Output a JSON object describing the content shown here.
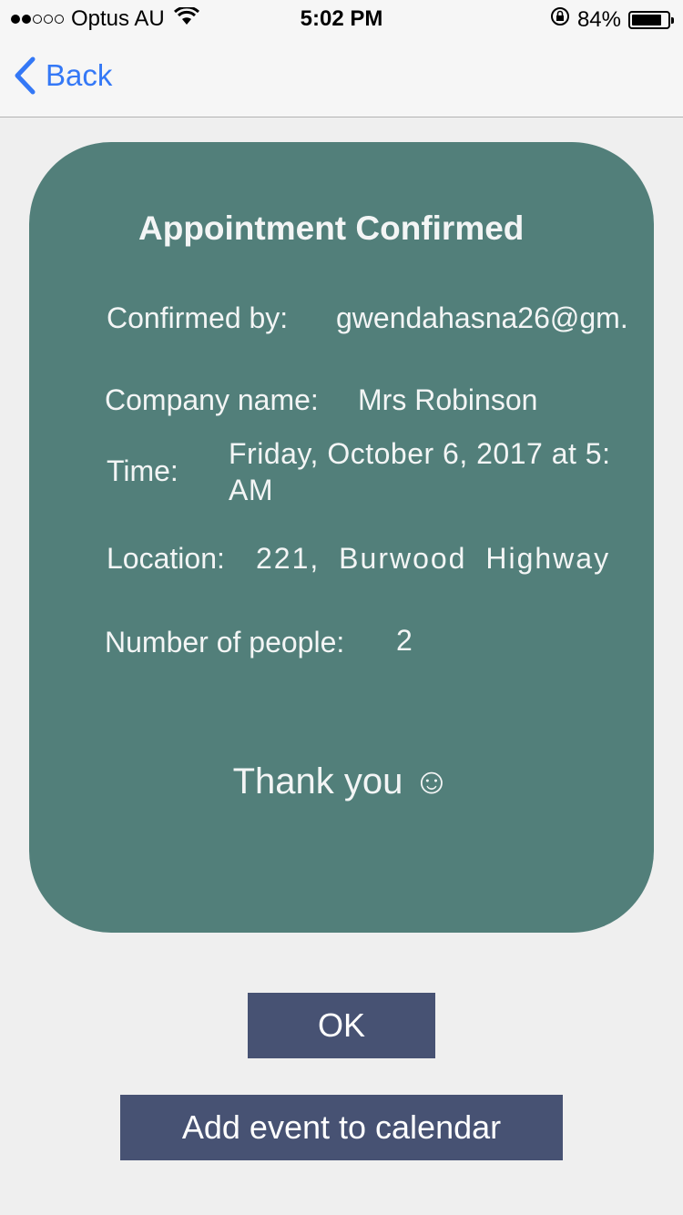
{
  "status_bar": {
    "carrier": "Optus AU",
    "time": "5:02 PM",
    "battery": "84%",
    "battery_level": 0.84,
    "signal_bars_filled": 2,
    "signal_bars_total": 5,
    "icons": [
      "wifi-icon",
      "orientation-lock-icon",
      "battery-icon"
    ]
  },
  "nav": {
    "back_label": "Back",
    "accent_color": "#3478f6"
  },
  "card": {
    "title": "Appointment Confirmed",
    "confirmed_by_label": "Confirmed by:",
    "confirmed_by_value": "gwendahasna26@gm.",
    "company_label": "Company name:",
    "company_value": "Mrs Robinson",
    "time_label": "Time:",
    "time_value_line1": "Friday, October 6, 2017 at 5:",
    "time_value_line2": "AM",
    "location_label": "Location:",
    "location_value": "221, Burwood Highway",
    "people_label": "Number of people:",
    "people_value": "2",
    "thank_you": "Thank you ☺",
    "background_color": "#527f7a"
  },
  "buttons": {
    "ok_label": "OK",
    "calendar_label": "Add event to calendar",
    "button_color": "#475273"
  }
}
